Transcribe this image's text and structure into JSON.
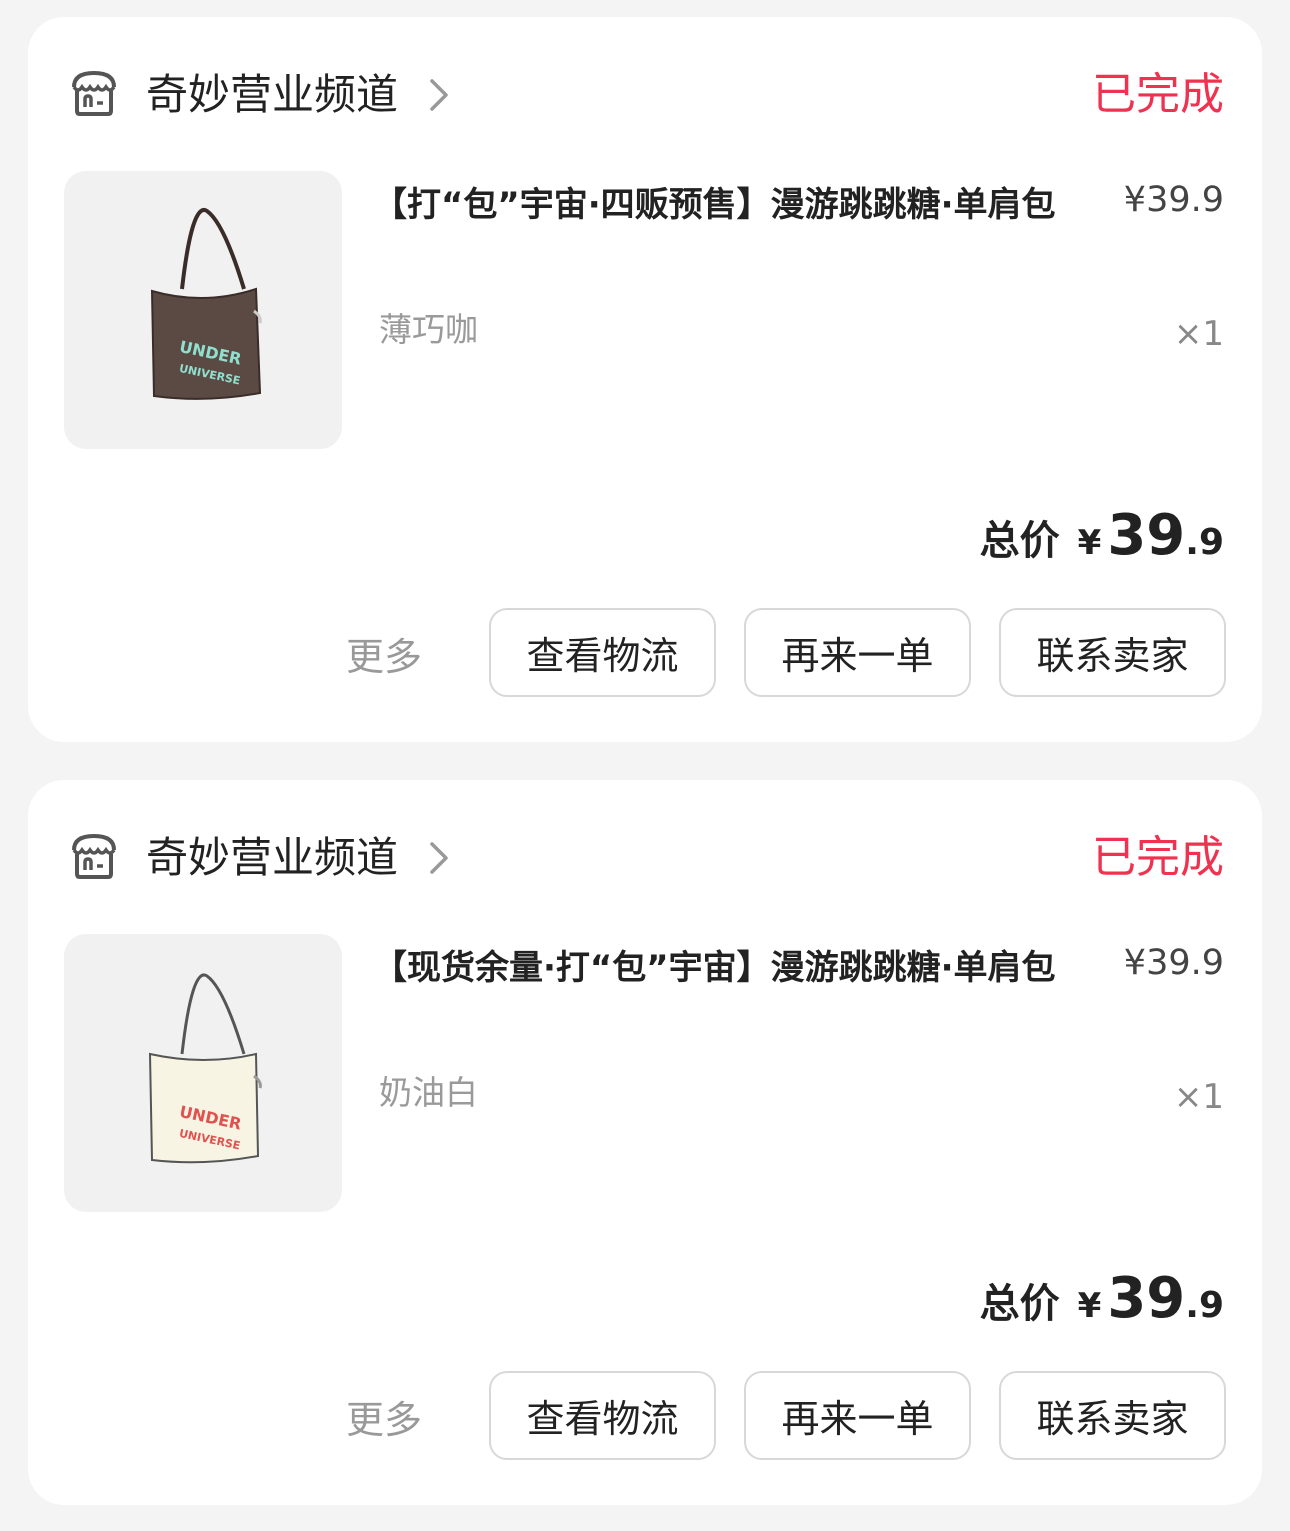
{
  "orders": [
    {
      "shop_name": "奇妙营业频道",
      "shop_icon": "store-icon",
      "status": "已完成",
      "status_color": "#ef3250",
      "product_title": "【打“包”宇宙·四贩预售】漫游跳跳糖·单肩包",
      "variant": "薄巧咖",
      "price": "¥39.9",
      "quantity": "×1",
      "total_label": "总价",
      "total_currency": "¥",
      "total_integer": "39",
      "total_decimal": ".9",
      "image_text": [
        "UNDER",
        "UNIVERSE"
      ],
      "more_label": "更多",
      "actions": [
        "查看物流",
        "再来一单",
        "联系卖家"
      ]
    },
    {
      "shop_name": "奇妙营业频道",
      "shop_icon": "store-icon",
      "status": "已完成",
      "status_color": "#ef3250",
      "product_title": "【现货余量·打“包”宇宙】漫游跳跳糖·单肩包",
      "variant": "奶油白",
      "price": "¥39.9",
      "quantity": "×1",
      "total_label": "总价",
      "total_currency": "¥",
      "total_integer": "39",
      "total_decimal": ".9",
      "image_text": [
        "UNDER",
        "UNIVERSE"
      ],
      "more_label": "更多",
      "actions": [
        "查看物流",
        "再来一单",
        "联系卖家"
      ]
    }
  ]
}
